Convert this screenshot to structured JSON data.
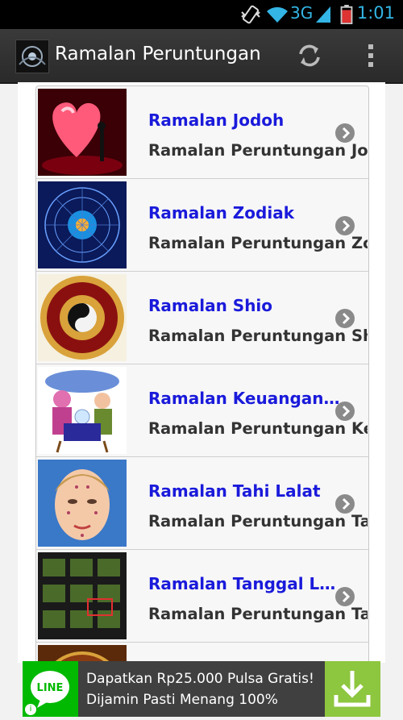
{
  "status_bar": {
    "network": "3G",
    "time": "1:01"
  },
  "action_bar": {
    "title": "Ramalan Peruntungan"
  },
  "items": [
    {
      "title": "Ramalan Jodoh",
      "subtitle": "Ramalan Peruntungan Jodoh"
    },
    {
      "title": "Ramalan Zodiak",
      "subtitle": "Ramalan Peruntungan Zodiak"
    },
    {
      "title": "Ramalan Shio",
      "subtitle": "Ramalan Peruntungan Shio"
    },
    {
      "title": "Ramalan Keuangan …",
      "subtitle": "Ramalan Peruntungan Keuangan"
    },
    {
      "title": "Ramalan Tahi Lalat",
      "subtitle": "Ramalan Peruntungan Tahi Lalat"
    },
    {
      "title": "Ramalan Tanggal L…",
      "subtitle": "Ramalan Peruntungan Tanggal Lahir"
    }
  ],
  "ad": {
    "brand": "LINE",
    "line1": "Dapatkan Rp25.000 Pulsa Gratis!",
    "line2": "Dijamin Pasti Menang 100%",
    "info": "i"
  },
  "colors": {
    "accent": "#33b5e5",
    "title_blue": "#1a1adb",
    "line_green": "#00b900",
    "download_green": "#8dc63f"
  },
  "icons": [
    "vibrate-icon",
    "wifi-icon",
    "signal-icon",
    "battery-icon",
    "refresh-icon",
    "overflow-menu-icon",
    "chevron-right-icon",
    "download-icon"
  ]
}
